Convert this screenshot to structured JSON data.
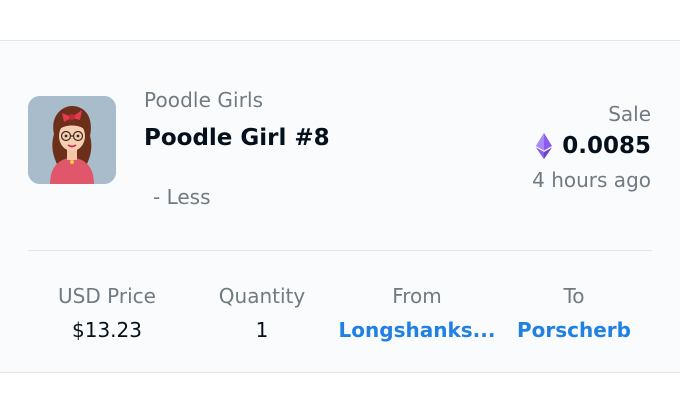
{
  "item": {
    "collection": "Poodle Girls",
    "name": "Poodle Girl #8",
    "toggle_label": "- Less",
    "thumbnail_icon": "poodle-girl-avatar"
  },
  "event": {
    "type": "Sale",
    "price": "0.0085",
    "currency_icon": "ethereum-icon",
    "time_ago": "4 hours ago"
  },
  "details": {
    "usd_price_label": "USD Price",
    "usd_price_value": "$13.23",
    "quantity_label": "Quantity",
    "quantity_value": "1",
    "from_label": "From",
    "from_value": "Longshanks...",
    "to_label": "To",
    "to_value": "Porscherb"
  },
  "colors": {
    "link": "#2081e2",
    "muted": "#707a83",
    "primary_text": "#04111d",
    "ethereum_purple": "#8a5cf0"
  }
}
